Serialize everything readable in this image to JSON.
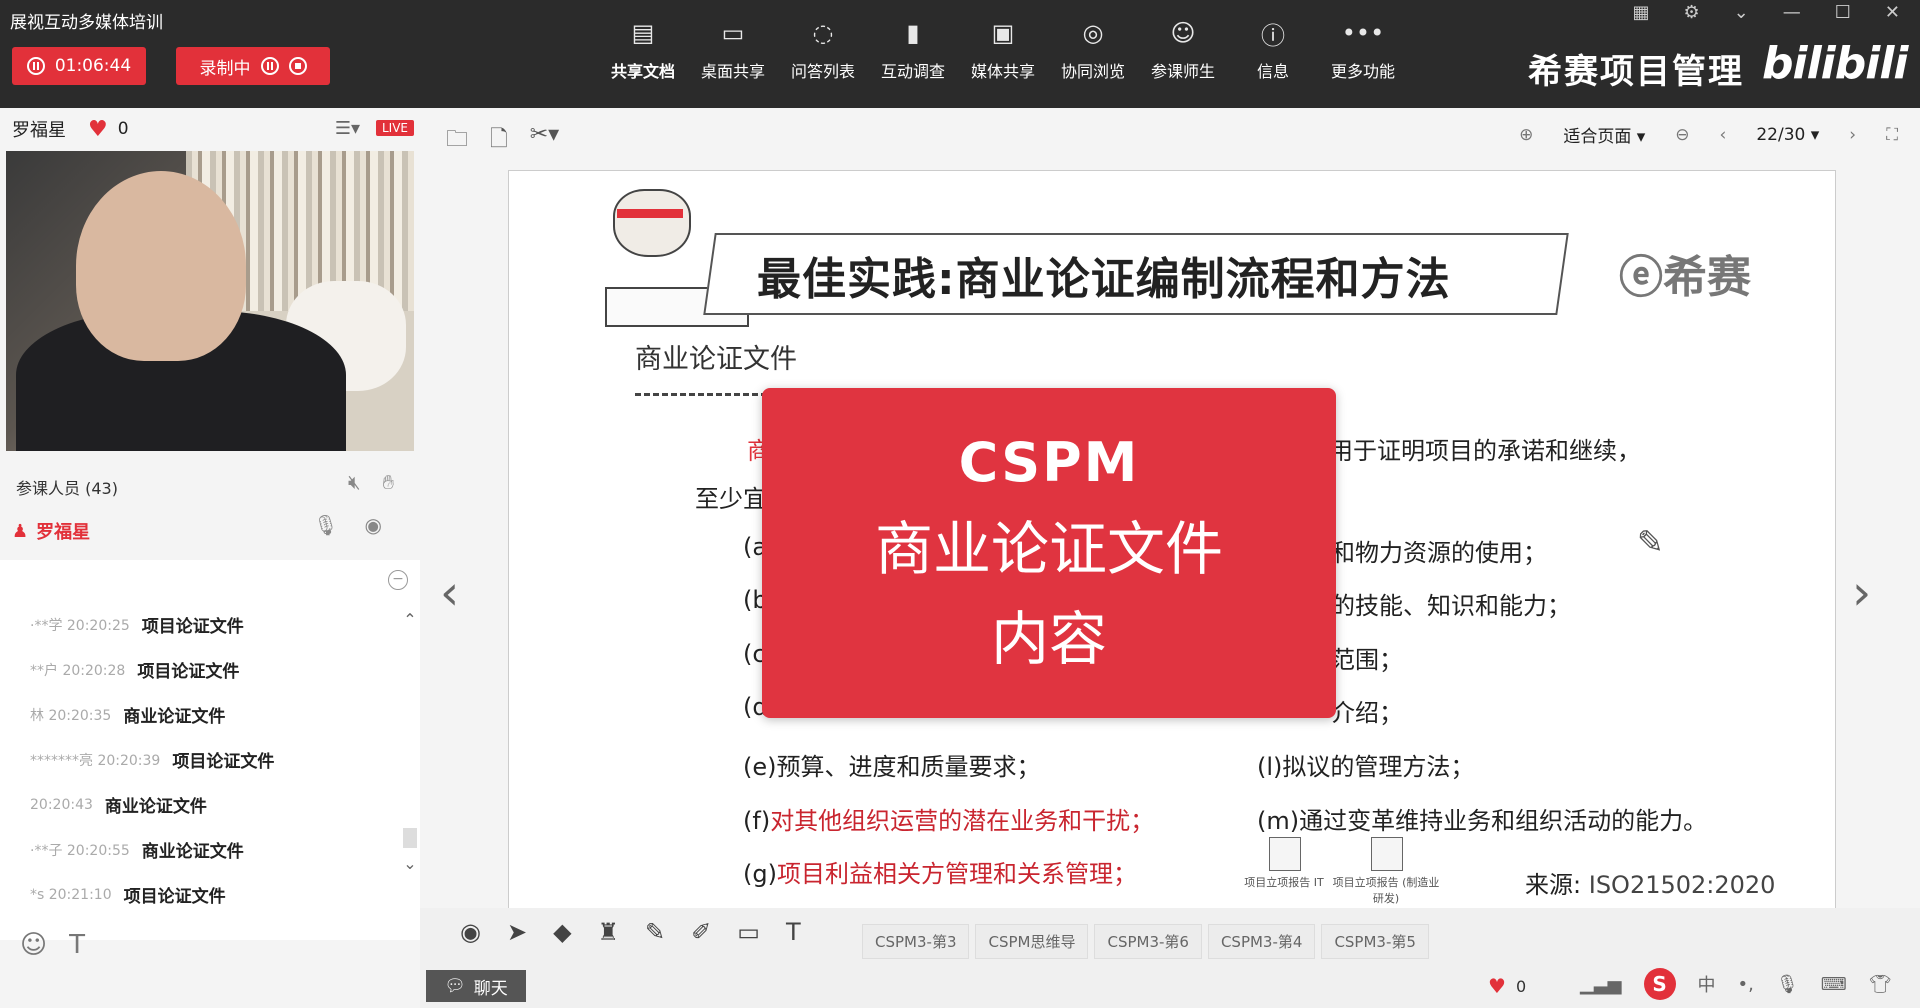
{
  "app": {
    "title": "展视互动多媒体培训",
    "timer": "01:06:44",
    "recording_label": "录制中"
  },
  "toolbar": {
    "items": [
      {
        "label": "共享文档",
        "icon": "document-share-icon",
        "glyph": "▤"
      },
      {
        "label": "桌面共享",
        "icon": "desktop-share-icon",
        "glyph": "▭"
      },
      {
        "label": "问答列表",
        "icon": "qa-list-icon",
        "glyph": "◌"
      },
      {
        "label": "互动调查",
        "icon": "survey-chart-icon",
        "glyph": "▮"
      },
      {
        "label": "媒体共享",
        "icon": "media-share-icon",
        "glyph": "▣"
      },
      {
        "label": "协同浏览",
        "icon": "compass-icon",
        "glyph": "◎"
      },
      {
        "label": "参课师生",
        "icon": "people-icon",
        "glyph": "☺"
      },
      {
        "label": "信息",
        "icon": "info-icon",
        "glyph": "ⓘ"
      },
      {
        "label": "更多功能",
        "icon": "more-icon",
        "glyph": "•••"
      }
    ]
  },
  "brand": {
    "name": "希赛项目管理",
    "bili": "bilibili"
  },
  "host": {
    "name": "罗福星",
    "likes": "0",
    "live": "LIVE"
  },
  "attendees": {
    "label": "参课人员 (43)",
    "me": "罗福星"
  },
  "chat": {
    "messages": [
      {
        "who": "·**学 20:20:25",
        "text": "项目论证文件"
      },
      {
        "who": "**户 20:20:28",
        "text": "项目论证文件"
      },
      {
        "who": "林 20:20:35",
        "text": "商业论证文件"
      },
      {
        "who": "*******亮 20:20:39",
        "text": "项目论证文件"
      },
      {
        "who": "20:20:43",
        "text": "商业论证文件"
      },
      {
        "who": "·**子 20:20:55",
        "text": "商业论证文件"
      },
      {
        "who": "*s 20:21:10",
        "text": "项目论证文件"
      }
    ]
  },
  "doc": {
    "fit_label": "适合页面",
    "page": "22/30"
  },
  "slide": {
    "title": "最佳实践:商业论证编制流程和方法",
    "logo": "ⓔ希赛",
    "subhead": "商业论证文件",
    "intro_start": "商",
    "intro_end": "用于证明项目的承诺和继续，",
    "at_least": "至少宜",
    "left_items": [
      {
        "text": "(a",
        "red": false
      },
      {
        "text": "(b",
        "red": false
      },
      {
        "text": "(c",
        "red": false
      },
      {
        "text": "(d",
        "red": false
      },
      {
        "text": "(e)预算、进度和质量要求；",
        "red": false
      },
      {
        "text": "(f)",
        "red": false,
        "rest": "对其他组织运营的潜在业务和干扰；"
      },
      {
        "text": "(g)",
        "red": false,
        "rest": "项目利益相关方管理和关系管理；"
      }
    ],
    "right_items": [
      {
        "text": "和物力资源的使用；"
      },
      {
        "text": "的技能、知识和能力；"
      },
      {
        "text": "范围；"
      },
      {
        "text": "介绍；"
      },
      {
        "text": "(l)拟议的管理方法；"
      },
      {
        "text": "(m)通过变革维持业务和组织活动的能力。"
      }
    ],
    "files": [
      {
        "label": "项目立项报告 IT"
      },
      {
        "label": "项目立项报告 (制造业研发)"
      }
    ],
    "source_label": "来源:",
    "source_value": "ISO21502:2020"
  },
  "overlay": {
    "line1": "CSPM",
    "line2": "商业论证文件",
    "line3": "内容"
  },
  "bottom": {
    "tabs": [
      "CSPM3-第3",
      "CSPM思维导",
      "CSPM3-第6",
      "CSPM3-第4",
      "CSPM3-第5"
    ],
    "chat_tab": "聊天",
    "likes": "0",
    "ime": "中"
  },
  "colors": {
    "accent": "#e2313a",
    "topbar": "#2b2b2b"
  }
}
